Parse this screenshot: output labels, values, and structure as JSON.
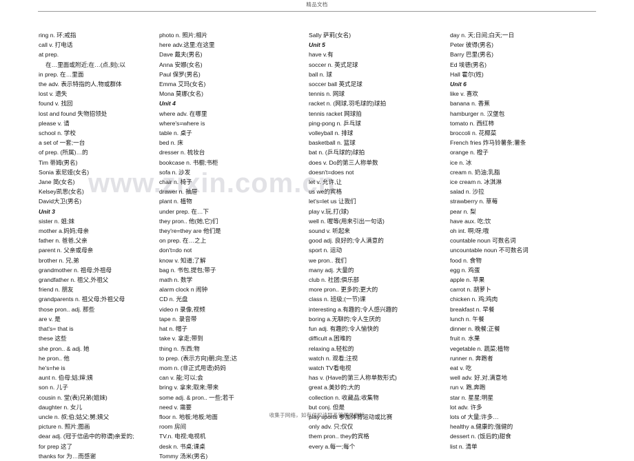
{
  "header": {
    "title": "精品文档"
  },
  "watermark": {
    "text": "www.zixin.com.cn"
  },
  "footer": {
    "notice": "收集于网络，如有侵权请联系管理员删除"
  },
  "columns": [
    {
      "name": "column-1",
      "entries": [
        {
          "text": "ring n. 环;戒指",
          "style": "normal"
        },
        {
          "text": "call v. 打电话",
          "style": "normal"
        },
        {
          "text": "at prep.",
          "style": "normal"
        },
        {
          "text": "在…里面或附近;在…(点,刻);以",
          "style": "cont"
        },
        {
          "text": "in prep. 在…里面",
          "style": "normal"
        },
        {
          "text": "the adv. 表示特指的人,物或群体",
          "style": "normal"
        },
        {
          "text": "lost v. 遗失",
          "style": "normal"
        },
        {
          "text": "found v. 找回",
          "style": "normal"
        },
        {
          "text": "lost and found 失物招领处",
          "style": "normal"
        },
        {
          "text": "please v. 请",
          "style": "normal"
        },
        {
          "text": "school n. 学校",
          "style": "normal"
        },
        {
          "text": "a set of 一套;一台",
          "style": "normal"
        },
        {
          "text": "of prep. (所属)…的",
          "style": "normal"
        },
        {
          "text": "Tim 蒂姆(男名)",
          "style": "normal"
        },
        {
          "text": "Sonia 索尼娅(女名)",
          "style": "normal"
        },
        {
          "text": "Jane 简(女名)",
          "style": "normal"
        },
        {
          "text": "Kelsey凯思(女名)",
          "style": "normal"
        },
        {
          "text": "David大卫(男名)",
          "style": "normal"
        },
        {
          "text": "Unit 3",
          "style": "unit-head"
        },
        {
          "text": "sister n. 姐;妹",
          "style": "normal"
        },
        {
          "text": "mother a.妈妈;母亲",
          "style": "normal"
        },
        {
          "text": "father n. 爸爸,父亲",
          "style": "normal"
        },
        {
          "text": "parent n. 父亲或母亲",
          "style": "normal"
        },
        {
          "text": "brother n. 兄,弟",
          "style": "normal"
        },
        {
          "text": "grandmother n. 祖母;外祖母",
          "style": "normal"
        },
        {
          "text": "grandfather n. 祖父,外祖父",
          "style": "normal"
        },
        {
          "text": "friend n. 朋友",
          "style": "normal"
        },
        {
          "text": "grandparents n. 祖父母;外祖父母",
          "style": "normal"
        },
        {
          "text": "those pron.. adj. 那些",
          "style": "normal"
        },
        {
          "text": "are v. 是",
          "style": "normal"
        },
        {
          "text": "that's= that is",
          "style": "normal"
        },
        {
          "text": "these 这些",
          "style": "normal"
        },
        {
          "text": "she pron.. & adj. 她",
          "style": "normal"
        },
        {
          "text": "he pron.. 他",
          "style": "normal"
        },
        {
          "text": "he's=he is",
          "style": "normal"
        },
        {
          "text": "aunt n. 伯母;姑;婶;姨",
          "style": "normal"
        },
        {
          "text": "son n. 儿子",
          "style": "normal"
        },
        {
          "text": "cousin n. 堂(表)兄弟(姐妹)",
          "style": "normal"
        },
        {
          "text": "daughter n. 女儿",
          "style": "normal"
        },
        {
          "text": "uncle n. 叔;伯;姑父;舅;姨父",
          "style": "normal"
        },
        {
          "text": "picture n. 照片;图画",
          "style": "normal"
        },
        {
          "text": "dear adj. (冠于信函中的称谓)亲爱的;",
          "style": "normal"
        },
        {
          "text": "for prep 这了",
          "style": "normal"
        },
        {
          "text": "thanks for 为…而感谢",
          "style": "normal"
        }
      ]
    },
    {
      "name": "column-2",
      "entries": [
        {
          "text": "photo n. 照片;相片",
          "style": "normal"
        },
        {
          "text": "here adv.这里;在这里",
          "style": "normal"
        },
        {
          "text": "Dave 戴夫(男名)",
          "style": "normal"
        },
        {
          "text": "Anna 安娜(女名)",
          "style": "normal"
        },
        {
          "text": "Paul 保罗(男名)",
          "style": "normal"
        },
        {
          "text": "Emma 艾玛(女名)",
          "style": "normal"
        },
        {
          "text": "Mona 莫娜(女名)",
          "style": "normal"
        },
        {
          "text": "Unit 4",
          "style": "unit-head"
        },
        {
          "text": "where adv. 在哪里",
          "style": "normal"
        },
        {
          "text": "where's=where is",
          "style": "normal"
        },
        {
          "text": "table n. 桌子",
          "style": "normal"
        },
        {
          "text": "bed n. 床",
          "style": "normal"
        },
        {
          "text": "dresser n. 梳妆台",
          "style": "normal"
        },
        {
          "text": "bookcase n. 书橱;书柜",
          "style": "normal"
        },
        {
          "text": "sofa n. 沙发",
          "style": "normal"
        },
        {
          "text": "chair n. 椅子",
          "style": "normal"
        },
        {
          "text": "drawer n. 抽屉",
          "style": "normal"
        },
        {
          "text": "plant n. 植物",
          "style": "normal"
        },
        {
          "text": "under prep. 在…下",
          "style": "normal"
        },
        {
          "text": "they pron.. 他(她,它)们",
          "style": "normal"
        },
        {
          "text": "they're=they are 他们是",
          "style": "normal"
        },
        {
          "text": "on prep. 在…之上",
          "style": "normal"
        },
        {
          "text": "don't=do not",
          "style": "normal"
        },
        {
          "text": "know v. 知道;了解",
          "style": "normal"
        },
        {
          "text": "bag n. 书包,提包;带子",
          "style": "normal"
        },
        {
          "text": "math n. 数学",
          "style": "normal"
        },
        {
          "text": "alarm clock n 闹钟",
          "style": "normal"
        },
        {
          "text": "CD n. 光盘",
          "style": "normal"
        },
        {
          "text": "video n 录像,视频",
          "style": "normal"
        },
        {
          "text": "tape n. 录音带",
          "style": "normal"
        },
        {
          "text": "hat n. 帽子",
          "style": "normal"
        },
        {
          "text": "take v. 拿走;带到",
          "style": "normal"
        },
        {
          "text": "thing n. 东西;物",
          "style": "normal"
        },
        {
          "text": "to prep. (表示方向)朝;向;至;达",
          "style": "normal"
        },
        {
          "text": "mom n. (非正式用语)妈妈",
          "style": "normal"
        },
        {
          "text": "can v. 能;可以;会",
          "style": "normal"
        },
        {
          "text": "bring v. 拿来;取来;带来",
          "style": "normal"
        },
        {
          "text": "some adj. & pron.. 一些;若干",
          "style": "normal"
        },
        {
          "text": "need v. 需要",
          "style": "normal"
        },
        {
          "text": "floor n. 地板;地板;地面",
          "style": "normal"
        },
        {
          "text": "room 房间",
          "style": "normal"
        },
        {
          "text": "TV.n. 电视;电视机",
          "style": "normal"
        },
        {
          "text": "desk n. 书桌;课桌",
          "style": "normal"
        },
        {
          "text": "Tommy 汤米(男名)",
          "style": "normal"
        }
      ]
    },
    {
      "name": "column-3",
      "entries": [
        {
          "text": "Sally 萨莉(女名)",
          "style": "normal"
        },
        {
          "text": "Unit 5",
          "style": "unit-head"
        },
        {
          "text": "have v.有",
          "style": "normal"
        },
        {
          "text": "soccer n. 英式足球",
          "style": "normal"
        },
        {
          "text": "ball n. 球",
          "style": "normal"
        },
        {
          "text": "soccer ball 英式足球",
          "style": "normal"
        },
        {
          "text": "tennis n. 网球",
          "style": "normal"
        },
        {
          "text": "racket n. (网球,羽毛球的)球拍",
          "style": "normal"
        },
        {
          "text": "tennis racket 网球拍",
          "style": "normal"
        },
        {
          "text": "ping-pong n. 乒乓球",
          "style": "normal"
        },
        {
          "text": "volleyball n. 排球",
          "style": "normal"
        },
        {
          "text": "basketball n. 篮球",
          "style": "normal"
        },
        {
          "text": "bat n. (乒乓球的)球拍",
          "style": "normal"
        },
        {
          "text": "does v. Do的第三人称单数",
          "style": "normal"
        },
        {
          "text": "doesn't=does not",
          "style": "normal"
        },
        {
          "text": "let v. 允许,让",
          "style": "normal"
        },
        {
          "text": "us we的宾格",
          "style": "normal"
        },
        {
          "text": "let's=let us 让我们",
          "style": "normal"
        },
        {
          "text": "play v.玩,打(球)",
          "style": "normal"
        },
        {
          "text": "well n. 喔等(用来引出一句话)",
          "style": "normal"
        },
        {
          "text": "sound v. 听起来",
          "style": "normal"
        },
        {
          "text": "good adj. 良好的;令人满意的",
          "style": "normal"
        },
        {
          "text": "sport n. 运动",
          "style": "normal"
        },
        {
          "text": "we pron.. 我们",
          "style": "normal"
        },
        {
          "text": "many adj. 大量的",
          "style": "normal"
        },
        {
          "text": "club n. 社团;俱乐部",
          "style": "normal"
        },
        {
          "text": "more pron.. 更多的;更大的",
          "style": "normal"
        },
        {
          "text": "class n. 班级;(一节)课",
          "style": "normal"
        },
        {
          "text": "interesting a.有趣的;令人感兴趣的",
          "style": "normal"
        },
        {
          "text": "boring a.无聊的;令人生厌的",
          "style": "normal"
        },
        {
          "text": "fun adj. 有趣的;令人愉快的",
          "style": "normal"
        },
        {
          "text": "difficult a.困难的",
          "style": "normal"
        },
        {
          "text": "relaxing a.轻松的",
          "style": "normal"
        },
        {
          "text": "watch n. 观看;注视",
          "style": "normal"
        },
        {
          "text": "watch TV看电视",
          "style": "normal"
        },
        {
          "text": "has v. (Have的第三人称单数形式)",
          "style": "normal"
        },
        {
          "text": "great a.美妙的;大的",
          "style": "normal"
        },
        {
          "text": "collection n. 收藏品;收集物",
          "style": "normal"
        },
        {
          "text": "but conj. 但是",
          "style": "normal"
        },
        {
          "text": "play sports 参加体育运动或比赛",
          "style": "normal"
        },
        {
          "text": "only adv. 只;仅仅",
          "style": "normal"
        },
        {
          "text": "them pron.. they的宾格",
          "style": "normal"
        },
        {
          "text": "every a.每一;每个",
          "style": "normal"
        }
      ]
    },
    {
      "name": "column-4",
      "entries": [
        {
          "text": "day n. 天;日间;白天;一日",
          "style": "normal"
        },
        {
          "text": "Peter 彼得(男名)",
          "style": "normal"
        },
        {
          "text": "Barry 巴里(男名)",
          "style": "normal"
        },
        {
          "text": "Ed 埃德(男名)",
          "style": "normal"
        },
        {
          "text": "Hall 霍尔(姓)",
          "style": "normal"
        },
        {
          "text": "Unit 6",
          "style": "unit-head"
        },
        {
          "text": "like v. 喜欢",
          "style": "normal"
        },
        {
          "text": "banana n. 香蕉",
          "style": "normal"
        },
        {
          "text": "hamburger n. 汉堡包",
          "style": "normal"
        },
        {
          "text": "tomato n. 西红柿",
          "style": "normal"
        },
        {
          "text": "broccoli n. 花椰菜",
          "style": "normal"
        },
        {
          "text": "French fries 炸马铃薯条;薯条",
          "style": "normal"
        },
        {
          "text": "orange n. 橙子",
          "style": "normal"
        },
        {
          "text": "ice n. 冰",
          "style": "normal"
        },
        {
          "text": "cream n. 奶油;乳脂",
          "style": "normal"
        },
        {
          "text": "ice cream n. 冰淇淋",
          "style": "normal"
        },
        {
          "text": "salad n. 沙拉",
          "style": "normal"
        },
        {
          "text": "strawberry n. 草莓",
          "style": "normal"
        },
        {
          "text": "pear n. 梨",
          "style": "normal"
        },
        {
          "text": "have aux. 吃;饮",
          "style": "normal"
        },
        {
          "text": "oh int. 啊;呀;哦",
          "style": "normal"
        },
        {
          "text": "countable noun 可数名词",
          "style": "normal"
        },
        {
          "text": "uncountable noun 不可数名词",
          "style": "normal"
        },
        {
          "text": "food n. 食物",
          "style": "normal"
        },
        {
          "text": "egg n. 鸡蛋",
          "style": "normal"
        },
        {
          "text": "apple n. 苹果",
          "style": "normal"
        },
        {
          "text": "carrot n. 胡萝卜",
          "style": "normal"
        },
        {
          "text": "chicken n. 鸡;鸡肉",
          "style": "normal"
        },
        {
          "text": "breakfast n. 早餐",
          "style": "normal"
        },
        {
          "text": "lunch n. 午餐",
          "style": "normal"
        },
        {
          "text": "dinner n. 晚餐;正餐",
          "style": "normal"
        },
        {
          "text": "fruit n. 水果",
          "style": "normal"
        },
        {
          "text": "vegetable n. 蔬菜;植物",
          "style": "normal"
        },
        {
          "text": "runner n. 奔跑者",
          "style": "normal"
        },
        {
          "text": "eat v. 吃",
          "style": "normal"
        },
        {
          "text": "well adv. 好,对,满意地",
          "style": "normal"
        },
        {
          "text": "run v. 跑,奔跑",
          "style": "normal"
        },
        {
          "text": "star n. 星星;明星",
          "style": "normal"
        },
        {
          "text": "lot adv. 许多",
          "style": "normal"
        },
        {
          "text": "lots of 大量;许多…",
          "style": "normal"
        },
        {
          "text": "healthy a.健康的;强健的",
          "style": "normal"
        },
        {
          "text": "dessert n. (饭后的)甜食",
          "style": "normal"
        },
        {
          "text": "list n. 清单",
          "style": "normal"
        }
      ]
    }
  ]
}
